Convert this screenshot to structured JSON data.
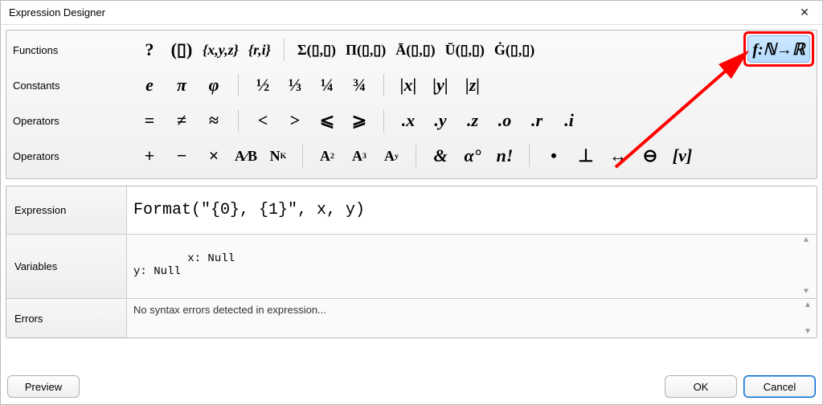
{
  "title": "Expression Designer",
  "rows": {
    "functions_label": "Functions",
    "constants_label": "Constants",
    "operators1_label": "Operators",
    "operators2_label": "Operators"
  },
  "functions": {
    "help": "?",
    "parens": "(▯)",
    "set_xyz": "{x,y,z}",
    "set_ri": "{r,i}",
    "sigma": "Σ(▯,▯)",
    "pi": "Π(▯,▯)",
    "abar": "Ā(▯,▯)",
    "ubar": "Ū(▯,▯)",
    "gdot": "Ġ(▯,▯)"
  },
  "special_button": "f:ℕ→ℝ",
  "constants": {
    "e": "e",
    "pi": "π",
    "phi": "φ",
    "half": "½",
    "third": "⅓",
    "quarter": "¼",
    "three_quarter": "¾",
    "abs_x": "|x|",
    "abs_y": "|y|",
    "abs_z": "|z|"
  },
  "operators1": {
    "eq": "=",
    "neq": "≠",
    "approx": "≈",
    "lt": "<",
    "gt": ">",
    "le": "⩽",
    "ge": "⩾",
    "dot_x": ".x",
    "dot_y": ".y",
    "dot_z": ".z",
    "dot_o": ".o",
    "dot_r": ".r",
    "dot_i": ".i"
  },
  "operators2": {
    "plus": "+",
    "minus": "−",
    "times": "×",
    "a_over_b": "A⁄B",
    "n_sub_k": "N",
    "n_sub_k_sub": "K",
    "a_sq": "A",
    "a_cu": "A",
    "a_y": "A",
    "amp": "&",
    "alpha_deg": "α°",
    "n_fact": "n!",
    "dot": "•",
    "perp": "⊥",
    "arrow_lr": "↔",
    "circle_minus": "⊖",
    "bracket_v": "[v]"
  },
  "expression": {
    "label": "Expression",
    "value": "Format(\"{0}, {1}\", x, y)"
  },
  "variables": {
    "label": "Variables",
    "value": "x: Null\ny: Null"
  },
  "errors": {
    "label": "Errors",
    "value": "No syntax errors detected in expression..."
  },
  "buttons": {
    "preview": "Preview",
    "ok": "OK",
    "cancel": "Cancel"
  }
}
